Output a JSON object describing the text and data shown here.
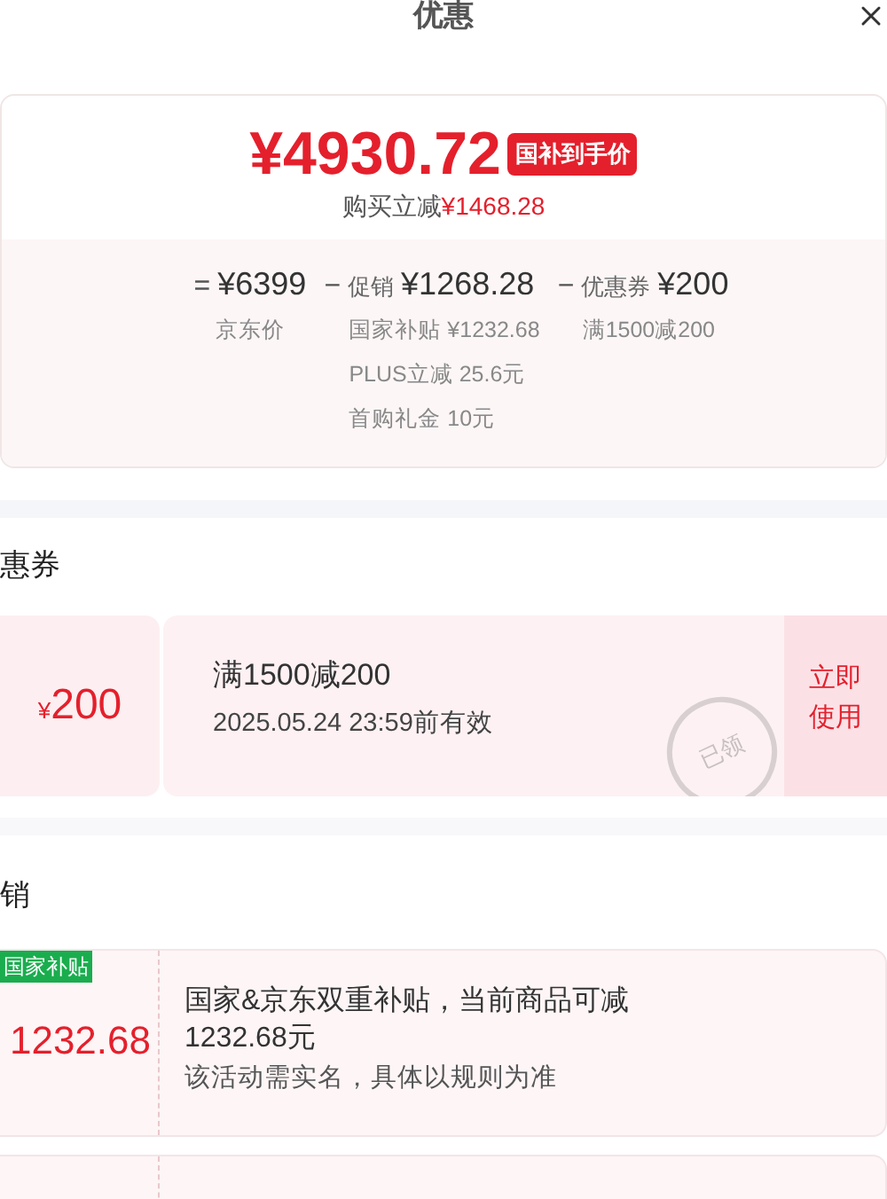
{
  "title": "优惠",
  "summary": {
    "final_price": "¥4930.72",
    "price_tag": "国补到手价",
    "saving_label": "购买立减",
    "saving_value": "¥1468.28",
    "breakdown": [
      {
        "op": "=",
        "value": "¥6399",
        "notes": [
          "京东价"
        ]
      },
      {
        "op": "−",
        "label": "促销",
        "value": "¥1268.28",
        "notes": [
          "国家补贴 ¥1232.68",
          "PLUS立减 25.6元",
          "首购礼金 10元"
        ]
      },
      {
        "op": "−",
        "label": "优惠券",
        "value": "¥200",
        "notes": [
          "满1500减200"
        ]
      }
    ]
  },
  "coupon_section": {
    "heading": "惠券",
    "coupons": [
      {
        "currency": "¥",
        "amount": "200",
        "title": "满1500减200",
        "validity": "2025.05.24 23:59前有效",
        "stamp": "已领",
        "action": "立即使用"
      }
    ]
  },
  "promo_section": {
    "heading": "销",
    "promos": [
      {
        "kind": "filled",
        "tag": "国家补贴",
        "amount": "1232.68",
        "text": "国家&京东双重补贴，当前商品可减1232.68元",
        "note": "该活动需实名，具体以规则为准"
      },
      {
        "kind": "empty"
      }
    ]
  }
}
